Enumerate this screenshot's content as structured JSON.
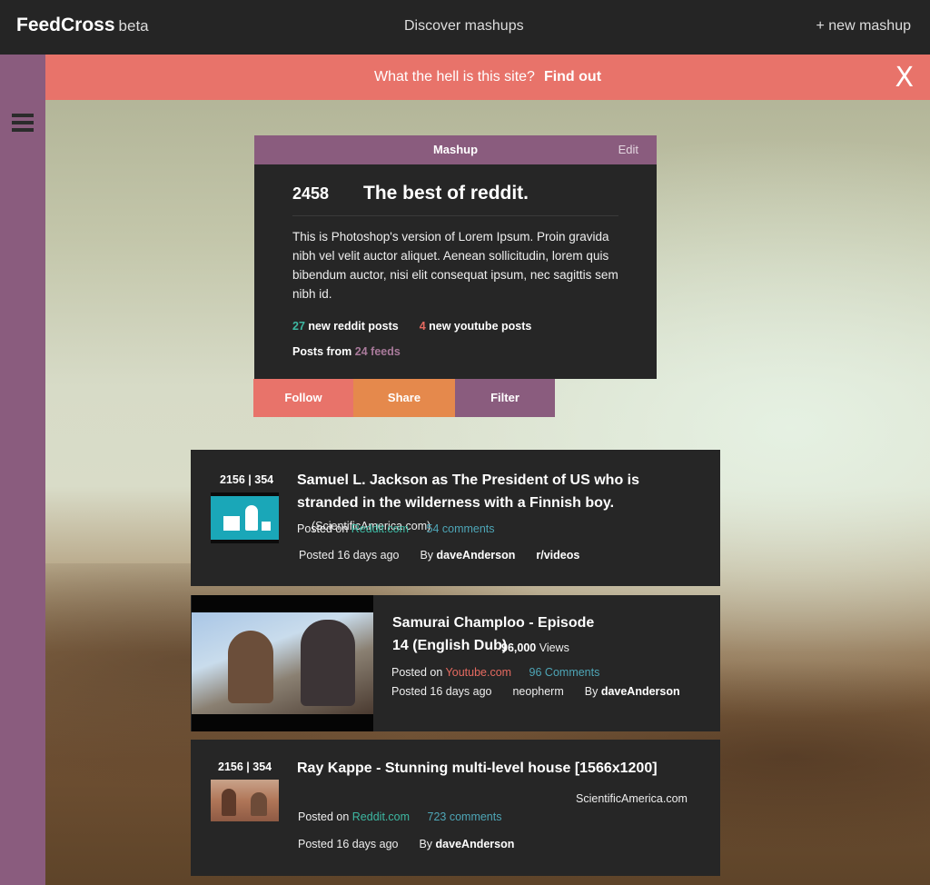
{
  "header": {
    "brand": "FeedCross",
    "brand_tag": "beta",
    "discover": "Discover mashups",
    "new_mashup": "+ new mashup"
  },
  "banner": {
    "question": "What the hell is this site?",
    "link": "Find out",
    "close": "X"
  },
  "mashup": {
    "header": "Mashup",
    "edit": "Edit",
    "count": "2458",
    "title": "The best of reddit.",
    "description": "This is Photoshop's version  of Lorem Ipsum. Proin gravida nibh vel velit auctor aliquet. Aenean sollicitudin, lorem quis bibendum auctor, nisi elit consequat ipsum, nec sagittis sem nibh id.",
    "reddit_new_count": "27",
    "reddit_new_label": "new reddit posts",
    "youtube_new_count": "4",
    "youtube_new_label": "new youtube posts",
    "posts_from": "Posts from",
    "feeds": "24 feeds",
    "actions": {
      "follow": "Follow",
      "share": "Share",
      "filter": "Filter"
    }
  },
  "posts": [
    {
      "votes": "2156 | 354",
      "title": "Samuel L. Jackson as The President of US who is stranded in the wilderness with a Finnish boy.",
      "source": "(ScientificAmerica.com)",
      "posted_on_label": "Posted on",
      "site": "Reddit.com",
      "comments": "54 comments",
      "posted": "Posted 16 days ago",
      "by_label": "By",
      "author": "daveAnderson",
      "subreddit": "r/videos"
    },
    {
      "title": "Samurai Champloo - Episode 14 (English Dub)",
      "views_count": "96,000",
      "views_label": "Views",
      "posted_on_label": "Posted on",
      "site": "Youtube.com",
      "comments": "96 Comments",
      "posted": "Posted 16 days ago",
      "channel": "neopherm",
      "by_label": "By",
      "author": "daveAnderson"
    },
    {
      "votes": "2156 | 354",
      "title": "Ray Kappe - Stunning multi-level house [1566x1200]",
      "source": "ScientificAmerica.com",
      "posted_on_label": "Posted on",
      "site": "Reddit.com",
      "comments": "723 comments",
      "posted": "Posted 16 days ago",
      "by_label": "By",
      "author": "daveAnderson"
    }
  ],
  "colors": {
    "coral": "#e8736a",
    "orange": "#e5894c",
    "purple": "#8a5c7e",
    "teal": "#3db8a2",
    "dark": "#262626"
  }
}
